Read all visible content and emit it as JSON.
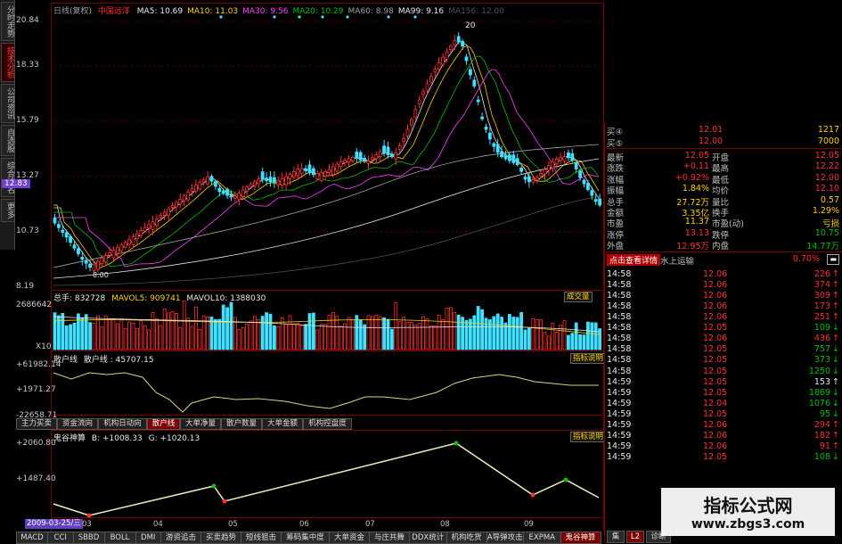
{
  "left_tabs": [
    "分时走势",
    "技术分析",
    "公司资讯",
    "自选股",
    "综合排名",
    "更多"
  ],
  "left_tab_active": 1,
  "main_header": {
    "period": "日线(复权)",
    "stock": "中国远洋",
    "ma": [
      {
        "label": "MA5: 10.69",
        "color": "#e8e8e8"
      },
      {
        "label": "MA10: 11.03",
        "color": "#ffd000"
      },
      {
        "label": "MA30: 9.56",
        "color": "#ff40ff"
      },
      {
        "label": "MA20: 10.29",
        "color": "#00c000"
      },
      {
        "label": "MA60: 8.98",
        "color": "#a0a0a0"
      },
      {
        "label": "MA99: 9.16",
        "color": "#e8e8e8"
      },
      {
        "label": "MA156: 12.00",
        "color": "#505050"
      }
    ]
  },
  "price_axis": [
    "20.84",
    "18.33",
    "15.79",
    "13.27",
    "12.83",
    "10.73",
    "8.19"
  ],
  "price_axis_highlight": "12.83",
  "price_annotations": {
    "high": "20",
    "low": "8.00"
  },
  "volume_panel": {
    "title": "总手: 832728",
    "ma5": "MAVOL5: 909741",
    "ma10": "MAVOL10: 1388030",
    "axis": [
      "2686642",
      "X10"
    ],
    "button": "成交量"
  },
  "hushou_panel": {
    "title": "散户线",
    "value": "散户线 : 45707.15",
    "axis": [
      "+61982.14",
      "+1971.27",
      "-22658.71"
    ],
    "button": "指标说明"
  },
  "mid_tabs": [
    "主力买卖",
    "资金流向",
    "机构日动向",
    "散户线",
    "大单净量",
    "散户数量",
    "大单金额",
    "机构控盘度"
  ],
  "mid_tab_active": 3,
  "ghost_panel": {
    "title": "鬼谷神算",
    "b": "B: +1008.33",
    "g": "G: +1020.13",
    "axis": [
      "+2060.80",
      "+1487.40"
    ],
    "button": "指标说明"
  },
  "date_axis": {
    "current": "2009-03-25/三",
    "months": [
      "03",
      "04",
      "05",
      "06",
      "07",
      "08",
      "09"
    ]
  },
  "bottom_tabs": [
    "MACD",
    "CCI",
    "SBBD",
    "BOLL",
    "DMI",
    "游资追击",
    "买卖趋势",
    "短线狙击",
    "筹码集中度",
    "大单资金",
    "与庄共舞",
    "DDX统计",
    "机构吃货",
    "A导弹攻击",
    "EXPMA",
    "鬼谷神算"
  ],
  "bottom_tab_active": 15,
  "quote": {
    "buy_rows": [
      {
        "label": "买④",
        "price": "12.01",
        "vol": "1217"
      },
      {
        "label": "买⑤",
        "price": "12.00",
        "vol": "7000"
      }
    ],
    "stats": [
      {
        "l": "最新",
        "v": "12.05",
        "vc": "#ff3030",
        "l2": "开盘",
        "v2": "12.05",
        "v2c": "#ff3030"
      },
      {
        "l": "涨跌",
        "v": "+0.11",
        "vc": "#ff3030",
        "l2": "最高",
        "v2": "12.22",
        "v2c": "#ff3030"
      },
      {
        "l": "涨幅",
        "v": "+0.92%",
        "vc": "#ff3030",
        "l2": "最低",
        "v2": "12.00",
        "v2c": "#ff3030"
      },
      {
        "l": "振幅",
        "v": "1.84%",
        "vc": "#ffd000",
        "l2": "均价",
        "v2": "12.10",
        "v2c": "#ff3030"
      },
      {
        "l": "总手",
        "v": "27.72万",
        "vc": "#ffd000",
        "l2": "量比",
        "v2": "0.57",
        "v2c": "#ffd000"
      },
      {
        "l": "金额",
        "v": "3.35亿",
        "vc": "#ffd000",
        "l2": "换手",
        "v2": "1.29%",
        "v2c": "#ffd000"
      },
      {
        "l": "市盈",
        "v": "11.37",
        "vc": "#ffd000",
        "l2": "市盈(动)",
        "v2": "亏损",
        "v2c": "#ffd000"
      },
      {
        "l": "涨停",
        "v": "13.13",
        "vc": "#ff3030",
        "l2": "跌停",
        "v2": "10.75",
        "v2c": "#00c000"
      },
      {
        "l": "外盘",
        "v": "12.95万",
        "vc": "#ff3030",
        "l2": "内盘",
        "v2": "14.77万",
        "v2c": "#00c000"
      }
    ],
    "detail_button": "点击查看详情",
    "sector": "水上运输",
    "sector_change": "0.70%"
  },
  "ticks": [
    {
      "t": "14:58",
      "p": "12.06",
      "v": "226",
      "d": "up"
    },
    {
      "t": "14:58",
      "p": "12.06",
      "v": "374",
      "d": "up"
    },
    {
      "t": "14:58",
      "p": "12.06",
      "v": "309",
      "d": "up"
    },
    {
      "t": "14:58",
      "p": "12.06",
      "v": "173",
      "d": "up"
    },
    {
      "t": "14:58",
      "p": "12.06",
      "v": "251",
      "d": "up"
    },
    {
      "t": "14:58",
      "p": "12.05",
      "v": "109",
      "d": "down"
    },
    {
      "t": "14:58",
      "p": "12.06",
      "v": "436",
      "d": "up"
    },
    {
      "t": "14:58",
      "p": "12.05",
      "v": "757",
      "d": "down"
    },
    {
      "t": "14:58",
      "p": "12.05",
      "v": "373",
      "d": "down"
    },
    {
      "t": "14:58",
      "p": "12.05",
      "v": "1250",
      "d": "down"
    },
    {
      "t": "14:59",
      "p": "12.05",
      "v": "153",
      "d": "flat"
    },
    {
      "t": "14:59",
      "p": "12.05",
      "v": "1869",
      "d": "down"
    },
    {
      "t": "14:59",
      "p": "12.04",
      "v": "1076",
      "d": "down"
    },
    {
      "t": "14:59",
      "p": "12.05",
      "v": "95",
      "d": "down"
    },
    {
      "t": "14:59",
      "p": "12.06",
      "v": "294",
      "d": "up"
    },
    {
      "t": "14:59",
      "p": "12.06",
      "v": "182",
      "d": "up"
    },
    {
      "t": "14:59",
      "p": "12.06",
      "v": "91",
      "d": "up"
    },
    {
      "t": "14:59",
      "p": "12.05",
      "v": "108",
      "d": "down"
    }
  ],
  "right_bottom_tabs": [
    "集",
    "L2",
    "诊断"
  ],
  "watermark": {
    "title": "指标公式网",
    "url": "www.zbgs3.com"
  }
}
